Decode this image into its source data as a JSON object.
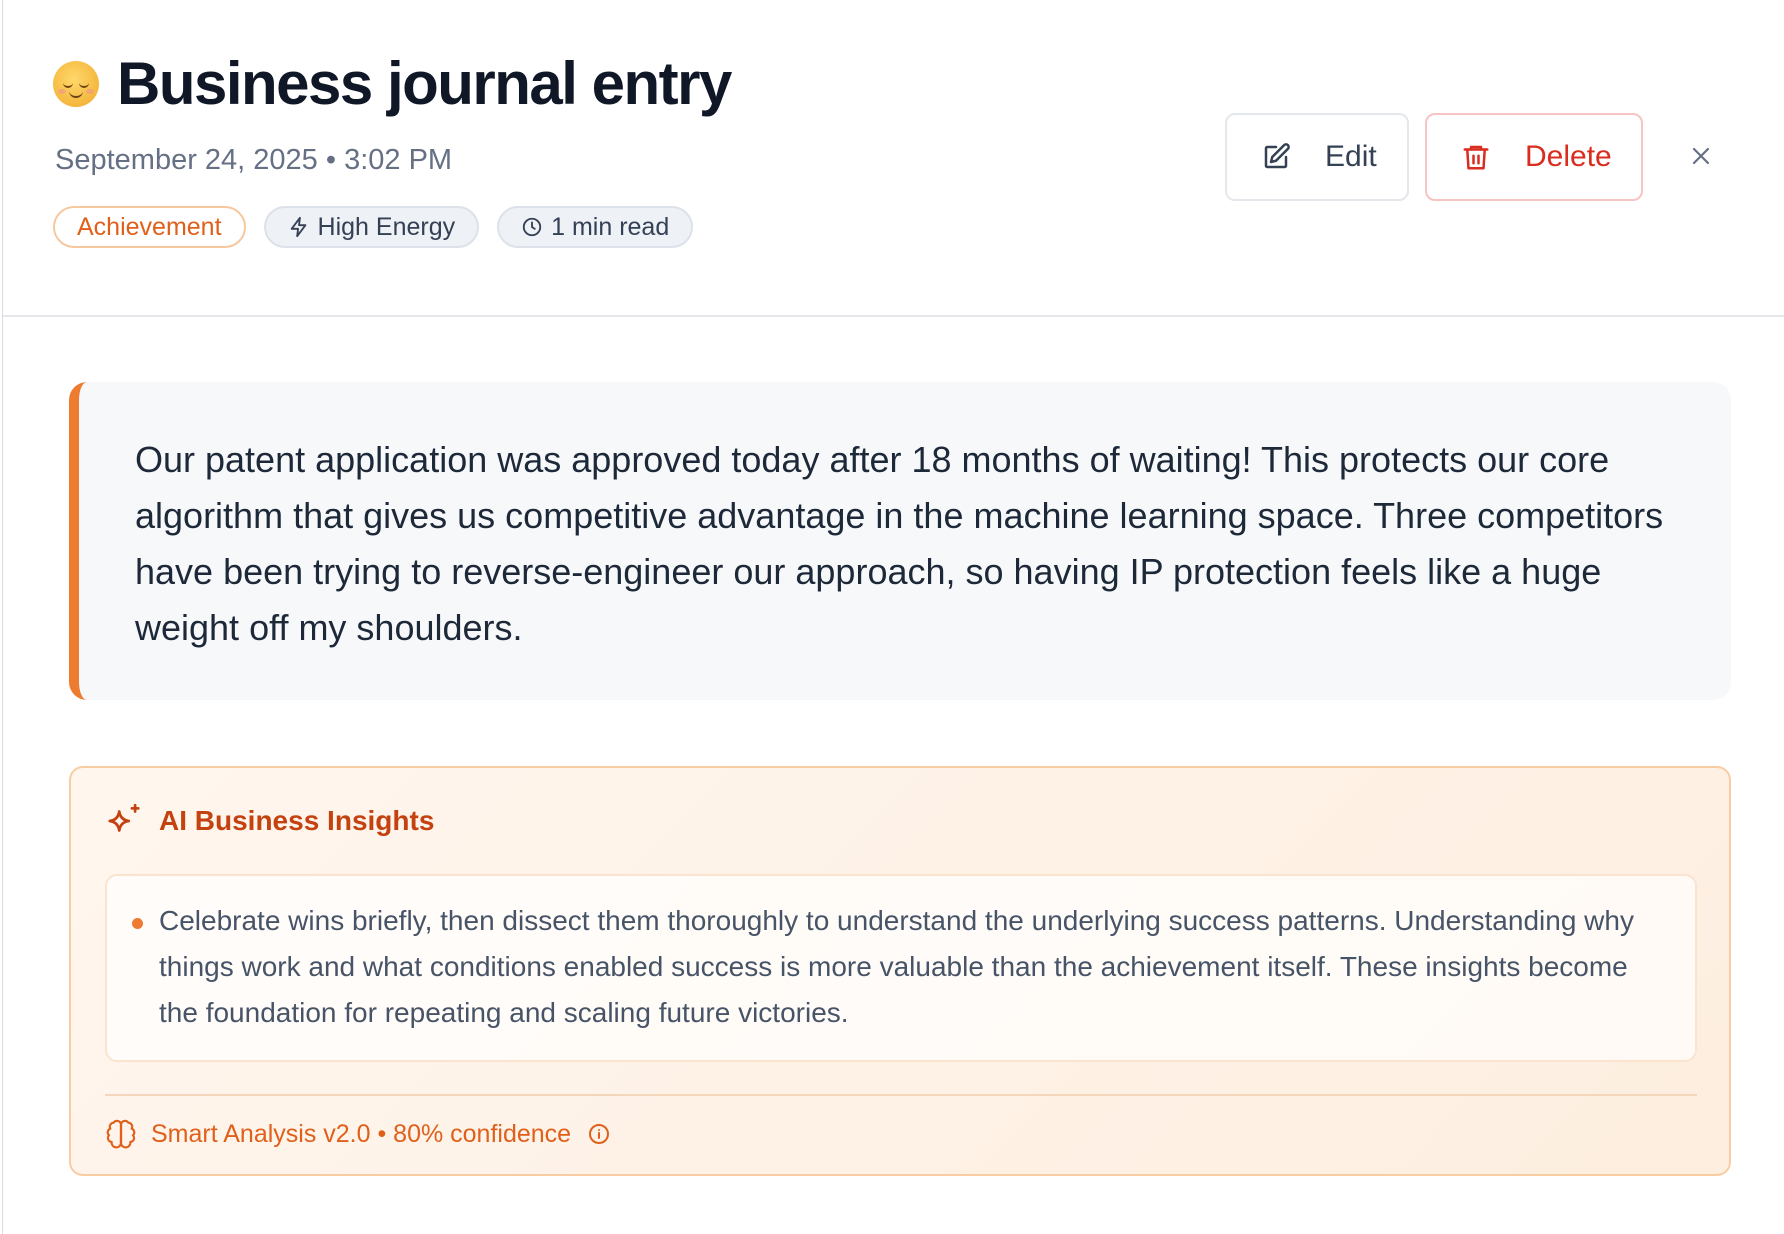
{
  "header": {
    "title": "Business journal entry",
    "mood_icon": "relieved-face-emoji",
    "date_time": "September 24, 2025 • 3:02 PM",
    "tags": [
      {
        "label": "Achievement",
        "icon": null
      },
      {
        "label": "High Energy",
        "icon": "lightning-icon"
      },
      {
        "label": "1 min read",
        "icon": "clock-icon"
      }
    ]
  },
  "actions": {
    "edit_label": "Edit",
    "delete_label": "Delete",
    "close_icon": "close-icon"
  },
  "entry": {
    "body": "Our patent application was approved today after 18 months of waiting! This protects our core algorithm that gives us competitive advantage in the machine learning space. Three competitors have been trying to reverse-engineer our approach, so having IP protection feels like a huge weight off my shoulders."
  },
  "insights": {
    "title": "AI Business Insights",
    "items": [
      "Celebrate wins briefly, then dissect them thoroughly to understand the underlying success patterns. Understanding why things work and what conditions enabled success is more valuable than the achievement itself. These insights become the foundation for repeating and scaling future victories."
    ],
    "footer": "Smart Analysis v2.0 • 80% confidence"
  },
  "colors": {
    "accent": "#ed7b30",
    "danger": "#d92d20",
    "insight_title": "#c4420f"
  }
}
